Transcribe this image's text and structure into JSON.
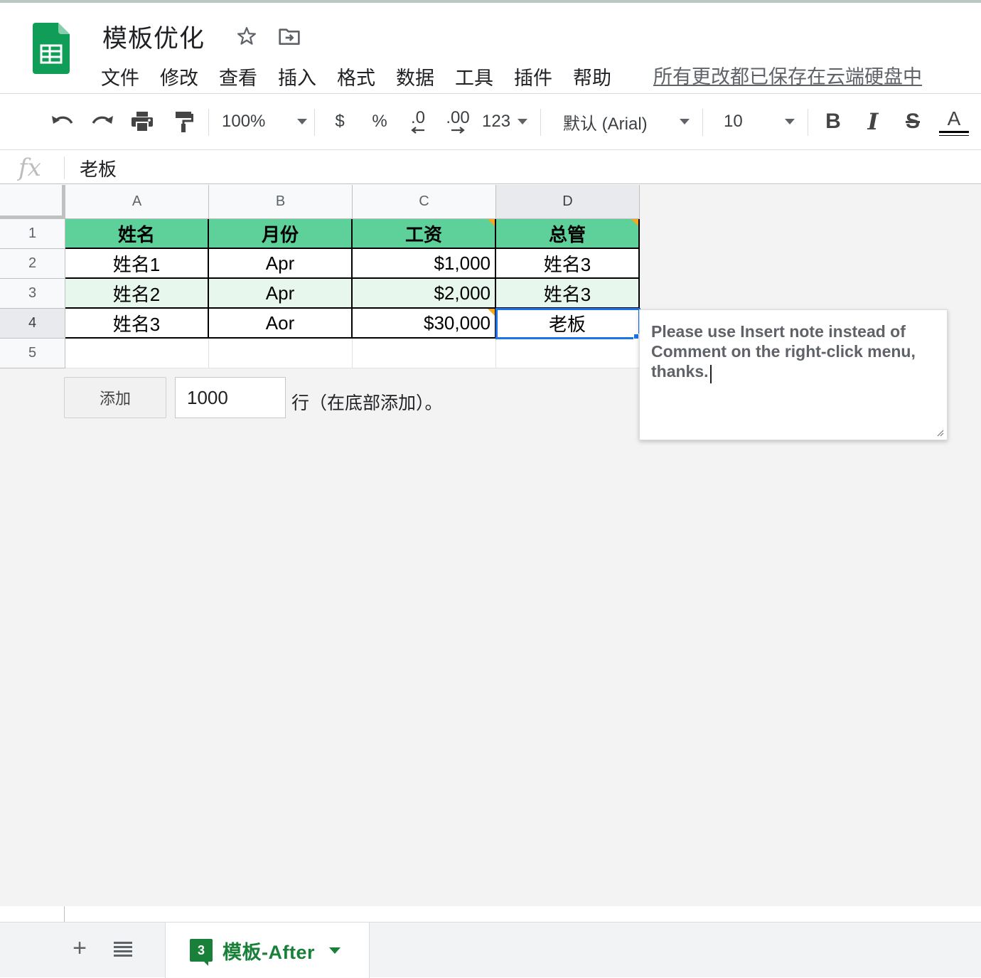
{
  "app": {
    "title": "模板优化",
    "save_status": "所有更改都已保存在云端硬盘中",
    "accent_color": "#188038"
  },
  "menu": [
    "文件",
    "修改",
    "查看",
    "插入",
    "格式",
    "数据",
    "工具",
    "插件",
    "帮助"
  ],
  "toolbar": {
    "zoom": "100%",
    "currency": "$",
    "percent": "%",
    "decrease_decimal": ".0",
    "increase_decimal": ".00",
    "more_formats": "123",
    "font": "默认 (Arial)",
    "font_size": "10",
    "bold": "B",
    "italic": "I",
    "strike": "S",
    "text_color": "A"
  },
  "formula_bar": {
    "fx": "fx",
    "value": "老板"
  },
  "sheet": {
    "columns": [
      "A",
      "B",
      "C",
      "D"
    ],
    "selected_column": "D",
    "rows": [
      "1",
      "2",
      "3",
      "4",
      "5"
    ],
    "selected_row": "4",
    "header_color": "#5ed09a",
    "band_color": "#e8f7ee",
    "header": [
      "姓名",
      "月份",
      "工资",
      "总管"
    ],
    "data": [
      [
        "姓名1",
        "Apr",
        "$1,000",
        "姓名3"
      ],
      [
        "姓名2",
        "Apr",
        "$2,000",
        "姓名3"
      ],
      [
        "姓名3",
        "Aor",
        "$30,000",
        "老板"
      ]
    ],
    "selected_cell": "D4"
  },
  "add_rows": {
    "button": "添加",
    "count": "1000",
    "suffix": "行（在底部添加）。"
  },
  "note": {
    "text": "Please use Insert note instead of Comment on the right-click menu, thanks."
  },
  "tabs": {
    "add_icon": "+",
    "active_tab_number": "3",
    "active_tab_label": "模板-After"
  }
}
